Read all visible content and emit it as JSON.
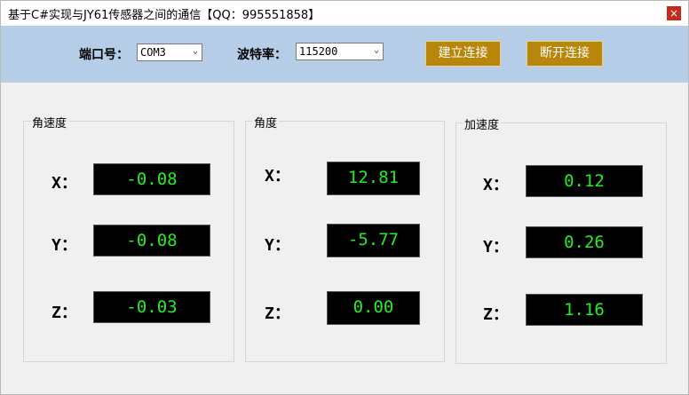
{
  "window": {
    "title": "基于C#实现与JY61传感器之间的通信【QQ：995551858】",
    "close_glyph": "×"
  },
  "toolbar": {
    "port_label": "端口号：",
    "port_value": "COM3",
    "baud_label": "波特率：",
    "baud_value": "115200",
    "connect_label": "建立连接",
    "disconnect_label": "断开连接"
  },
  "groups": {
    "angular_velocity": {
      "title": "角速度",
      "x_label": "X：",
      "x_value": "-0.08",
      "y_label": "Y：",
      "y_value": "-0.08",
      "z_label": "Z：",
      "z_value": "-0.03"
    },
    "angle": {
      "title": "角度",
      "x_label": "X：",
      "x_value": "12.81",
      "y_label": "Y：",
      "y_value": "-5.77",
      "z_label": "Z：",
      "z_value": "0.00"
    },
    "acceleration": {
      "title": "加速度",
      "x_label": "X：",
      "x_value": "0.12",
      "y_label": "Y：",
      "y_value": "0.26",
      "z_label": "Z：",
      "z_value": "1.16"
    }
  },
  "colors": {
    "toolbar_bg": "#b6cde8",
    "button_bg": "#b8860b",
    "display_bg": "#000000",
    "display_text": "#22ee22"
  },
  "icons": {
    "close": "close-icon",
    "dropdown": "chevron-down-icon"
  }
}
